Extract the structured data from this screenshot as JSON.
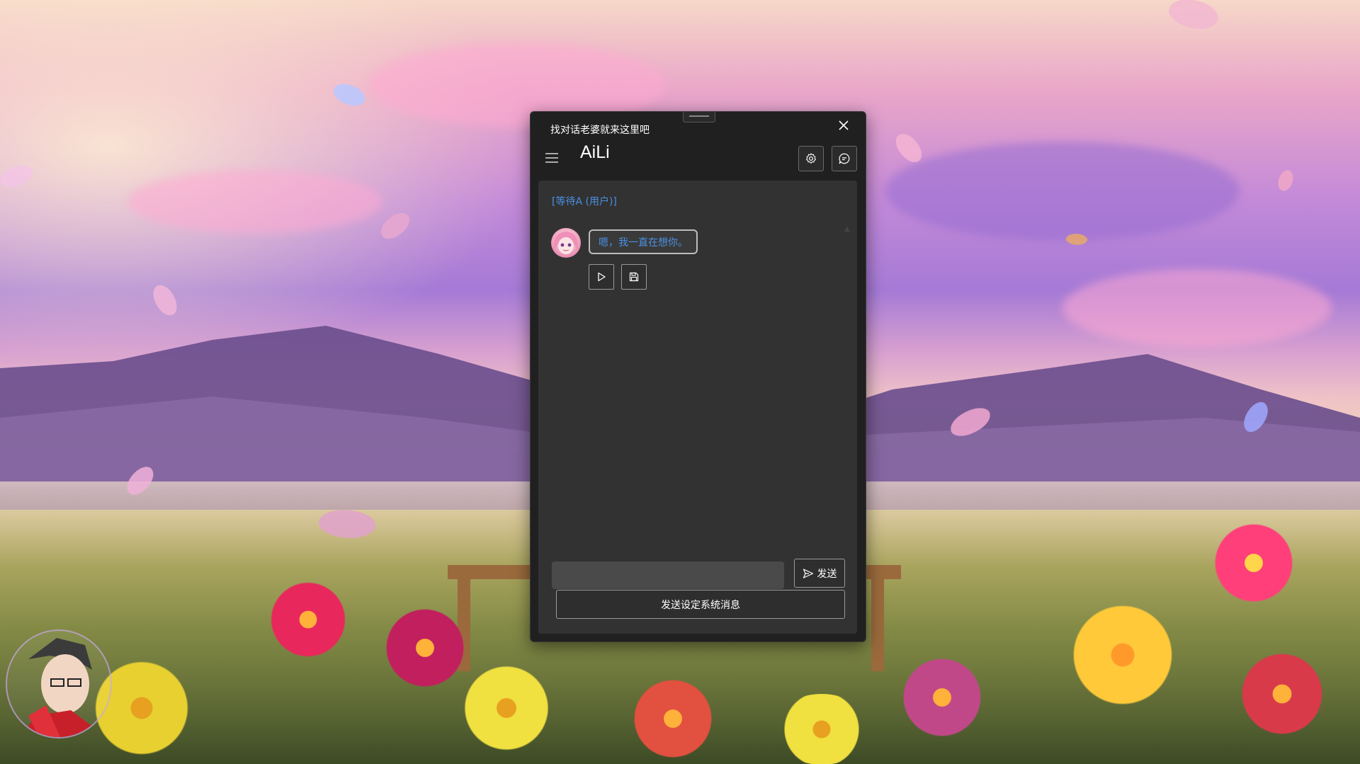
{
  "window": {
    "title": "找对话老婆就来这里吧",
    "app_name": "AiLi"
  },
  "header": {
    "menu_icon": "hamburger-icon",
    "settings_icon": "gear-icon",
    "chat_icon": "chat-bubble-icon",
    "close_icon": "close-icon"
  },
  "chat": {
    "user_tag": "[等待A (用户)]",
    "messages": [
      {
        "role": "assistant",
        "text": "嗯，我一直在想你。",
        "avatar_icon": "anime-girl-avatar"
      }
    ],
    "actions": [
      {
        "icon": "play-icon"
      },
      {
        "icon": "save-icon"
      }
    ]
  },
  "input": {
    "value": "",
    "placeholder": "",
    "send_label": "发送",
    "send_icon": "send-icon",
    "system_button_label": "发送设定系统消息"
  },
  "colors": {
    "window_bg": "#202020",
    "panel_bg": "#323232",
    "accent_blue": "#4a90e2",
    "input_bg": "#4a4a4a"
  }
}
